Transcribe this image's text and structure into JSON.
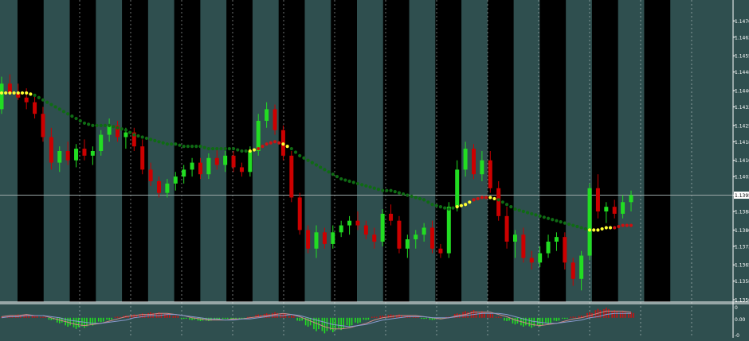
{
  "colors": {
    "background": "#2f4f4f",
    "band_dark": "#000000",
    "band_light": "#2f4f4f",
    "axis": "#ffffff",
    "bull": "#22dd22",
    "bear": "#cc0000",
    "ma_down": "#0f6b14",
    "ma_up": "#cc1111",
    "ma_flat": "#ffff33",
    "current_price_line": "#9aa6a6",
    "osc_pos": "#cc1111",
    "osc_neg": "#22dd22",
    "osc_line1": "#cc8888",
    "osc_line2": "#8899cc"
  },
  "chart_data": [
    {
      "type": "candlestick",
      "title": "",
      "price_axis": {
        "ticks": [
          "1.1470",
          "1.1463",
          "1.1455",
          "1.1448",
          "1.1440",
          "1.1433",
          "1.1425",
          "1.1418",
          "1.1410",
          "1.1403",
          "1.1395",
          "1.1388",
          "1.1380",
          "1.1373",
          "1.1365",
          "1.1358",
          "1.1350"
        ],
        "ylim": [
          1.1349,
          1.1479
        ],
        "current_price": 1.1395,
        "current_price_label": "1.1395"
      },
      "background_bands": 13,
      "candles": [
        [
          1.1432,
          1.1446,
          1.143,
          1.1443
        ],
        [
          1.1443,
          1.1447,
          1.1438,
          1.1439
        ],
        [
          1.1439,
          1.1443,
          1.1436,
          1.1437
        ],
        [
          1.1437,
          1.1441,
          1.1432,
          1.1435
        ],
        [
          1.1435,
          1.1438,
          1.1428,
          1.143
        ],
        [
          1.143,
          1.1433,
          1.1418,
          1.142
        ],
        [
          1.142,
          1.1424,
          1.1406,
          1.1409
        ],
        [
          1.1409,
          1.1416,
          1.1405,
          1.1414
        ],
        [
          1.1414,
          1.1418,
          1.1408,
          1.141
        ],
        [
          1.141,
          1.1417,
          1.1407,
          1.1415
        ],
        [
          1.1415,
          1.1419,
          1.141,
          1.1412
        ],
        [
          1.1412,
          1.1416,
          1.1408,
          1.1414
        ],
        [
          1.1414,
          1.1423,
          1.1412,
          1.1421
        ],
        [
          1.1421,
          1.1428,
          1.1418,
          1.1425
        ],
        [
          1.1425,
          1.1427,
          1.1418,
          1.142
        ],
        [
          1.142,
          1.1424,
          1.1415,
          1.1422
        ],
        [
          1.1422,
          1.1424,
          1.1414,
          1.1416
        ],
        [
          1.1416,
          1.1419,
          1.1404,
          1.1406
        ],
        [
          1.1406,
          1.1409,
          1.1399,
          1.1401
        ],
        [
          1.1401,
          1.1403,
          1.1394,
          1.1396
        ],
        [
          1.1396,
          1.1402,
          1.1394,
          1.14
        ],
        [
          1.14,
          1.1405,
          1.1397,
          1.1403
        ],
        [
          1.1403,
          1.1408,
          1.14,
          1.1406
        ],
        [
          1.1406,
          1.1411,
          1.1403,
          1.1409
        ],
        [
          1.1409,
          1.1411,
          1.1402,
          1.1404
        ],
        [
          1.1404,
          1.1413,
          1.1402,
          1.1411
        ],
        [
          1.1411,
          1.1415,
          1.1406,
          1.1408
        ],
        [
          1.1408,
          1.1414,
          1.1405,
          1.1412
        ],
        [
          1.1412,
          1.1414,
          1.1405,
          1.1407
        ],
        [
          1.1407,
          1.1409,
          1.1403,
          1.1405
        ],
        [
          1.1405,
          1.1416,
          1.1403,
          1.1414
        ],
        [
          1.1414,
          1.143,
          1.1412,
          1.1427
        ],
        [
          1.1427,
          1.1435,
          1.1424,
          1.1432
        ],
        [
          1.1432,
          1.1434,
          1.1421,
          1.1423
        ],
        [
          1.1423,
          1.1425,
          1.141,
          1.1412
        ],
        [
          1.1412,
          1.1414,
          1.1392,
          1.1394
        ],
        [
          1.1394,
          1.1396,
          1.1378,
          1.138
        ],
        [
          1.138,
          1.1382,
          1.137,
          1.1372
        ],
        [
          1.1372,
          1.1382,
          1.1368,
          1.1379
        ],
        [
          1.1379,
          1.1381,
          1.1372,
          1.1374
        ],
        [
          1.1374,
          1.1382,
          1.1372,
          1.1379
        ],
        [
          1.1379,
          1.1384,
          1.1377,
          1.1382
        ],
        [
          1.1382,
          1.1386,
          1.1378,
          1.1384
        ],
        [
          1.1384,
          1.1388,
          1.138,
          1.1382
        ],
        [
          1.1382,
          1.1384,
          1.1376,
          1.1378
        ],
        [
          1.1378,
          1.1381,
          1.1372,
          1.1375
        ],
        [
          1.1375,
          1.1389,
          1.1373,
          1.1387
        ],
        [
          1.1387,
          1.1391,
          1.1382,
          1.1384
        ],
        [
          1.1384,
          1.1386,
          1.137,
          1.1372
        ],
        [
          1.1372,
          1.1378,
          1.1368,
          1.1376
        ],
        [
          1.1376,
          1.138,
          1.1372,
          1.1378
        ],
        [
          1.1378,
          1.1383,
          1.1375,
          1.1381
        ],
        [
          1.1381,
          1.1384,
          1.137,
          1.1372
        ],
        [
          1.1372,
          1.1374,
          1.1368,
          1.137
        ],
        [
          1.137,
          1.1392,
          1.1368,
          1.139
        ],
        [
          1.139,
          1.141,
          1.1388,
          1.1406
        ],
        [
          1.1406,
          1.1418,
          1.1403,
          1.1415
        ],
        [
          1.1415,
          1.1417,
          1.1402,
          1.1404
        ],
        [
          1.1404,
          1.1414,
          1.1401,
          1.141
        ],
        [
          1.141,
          1.1414,
          1.1396,
          1.1398
        ],
        [
          1.1398,
          1.1401,
          1.1384,
          1.1386
        ],
        [
          1.1386,
          1.139,
          1.1372,
          1.1375
        ],
        [
          1.1375,
          1.138,
          1.1368,
          1.1378
        ],
        [
          1.1378,
          1.1381,
          1.1366,
          1.1368
        ],
        [
          1.1368,
          1.1371,
          1.1363,
          1.1366
        ],
        [
          1.1366,
          1.1373,
          1.1364,
          1.137
        ],
        [
          1.137,
          1.1378,
          1.1368,
          1.1375
        ],
        [
          1.1375,
          1.1379,
          1.1371,
          1.1377
        ],
        [
          1.1377,
          1.1379,
          1.1363,
          1.1366
        ],
        [
          1.1366,
          1.1368,
          1.1356,
          1.1359
        ],
        [
          1.1359,
          1.1371,
          1.1354,
          1.1369
        ],
        [
          1.1369,
          1.14,
          1.1367,
          1.1398
        ],
        [
          1.1398,
          1.1404,
          1.1385,
          1.1388
        ],
        [
          1.1388,
          1.1392,
          1.1383,
          1.139
        ],
        [
          1.139,
          1.1393,
          1.1385,
          1.1387
        ],
        [
          1.1387,
          1.1395,
          1.1385,
          1.1392
        ],
        [
          1.1392,
          1.1397,
          1.1388,
          1.1395
        ]
      ],
      "moving_average": [
        1.1439,
        1.1439,
        1.1439,
        1.1439,
        1.1438,
        1.1436,
        1.1434,
        1.1432,
        1.143,
        1.1428,
        1.1426,
        1.1425,
        1.1425,
        1.1425,
        1.1424,
        1.1423,
        1.1421,
        1.142,
        1.1419,
        1.1418,
        1.1417,
        1.1417,
        1.1416,
        1.1416,
        1.1416,
        1.1415,
        1.1415,
        1.1415,
        1.1415,
        1.1414,
        1.1414,
        1.1415,
        1.1417,
        1.1418,
        1.1417,
        1.1415,
        1.1412,
        1.141,
        1.1408,
        1.1406,
        1.1404,
        1.1402,
        1.1401,
        1.14,
        1.1399,
        1.1398,
        1.1397,
        1.1397,
        1.1396,
        1.1395,
        1.1394,
        1.1393,
        1.1391,
        1.139,
        1.1389,
        1.139,
        1.1391,
        1.1393,
        1.1394,
        1.1394,
        1.1393,
        1.1391,
        1.1389,
        1.1388,
        1.1387,
        1.1386,
        1.1385,
        1.1384,
        1.1383,
        1.1382,
        1.1381,
        1.138,
        1.138,
        1.1381,
        1.1381,
        1.1382,
        1.1382
      ],
      "moving_average_slope": [
        "flat",
        "flat",
        "flat",
        "flat",
        "down",
        "down",
        "down",
        "down",
        "down",
        "down",
        "down",
        "down",
        "down",
        "down",
        "down",
        "down",
        "down",
        "down",
        "down",
        "down",
        "down",
        "down",
        "down",
        "down",
        "down",
        "down",
        "down",
        "down",
        "down",
        "down",
        "flat",
        "up",
        "up",
        "up",
        "flat",
        "down",
        "down",
        "down",
        "down",
        "down",
        "down",
        "down",
        "down",
        "down",
        "down",
        "down",
        "down",
        "down",
        "down",
        "down",
        "down",
        "down",
        "down",
        "down",
        "down",
        "flat",
        "flat",
        "up",
        "up",
        "flat",
        "down",
        "down",
        "down",
        "down",
        "down",
        "down",
        "down",
        "down",
        "down",
        "down",
        "down",
        "flat",
        "flat",
        "flat",
        "up",
        "up",
        "up"
      ]
    },
    {
      "type": "histogram",
      "title": "",
      "axis": {
        "ticks": [
          "0",
          "0.00",
          "-0"
        ],
        "ylim": [
          -18,
          12
        ]
      },
      "values": [
        1,
        2,
        3,
        3,
        2,
        1,
        -2,
        -5,
        -8,
        -10,
        -9,
        -7,
        -4,
        -2,
        1,
        2,
        3,
        4,
        5,
        5,
        4,
        2,
        -1,
        -2,
        -3,
        -3,
        -2,
        -1,
        -1,
        -1,
        1,
        3,
        4,
        5,
        4,
        2,
        -3,
        -8,
        -12,
        -14,
        -13,
        -11,
        -8,
        -5,
        -2,
        1,
        2,
        3,
        3,
        2,
        1,
        -1,
        -2,
        -1,
        1,
        4,
        6,
        7,
        6,
        4,
        1,
        -3,
        -6,
        -8,
        -9,
        -8,
        -6,
        -3,
        -1,
        1,
        2,
        5,
        8,
        9,
        7,
        6,
        5
      ],
      "line1": [
        1,
        2,
        2,
        3,
        2,
        2,
        0,
        -2,
        -4,
        -6,
        -7,
        -6,
        -5,
        -3,
        -1,
        1,
        2,
        3,
        3,
        4,
        4,
        3,
        2,
        0,
        -1,
        -2,
        -2,
        -2,
        -1,
        -1,
        0,
        1,
        2,
        3,
        4,
        3,
        1,
        -2,
        -5,
        -8,
        -10,
        -10,
        -9,
        -7,
        -5,
        -2,
        0,
        1,
        2,
        2,
        2,
        1,
        0,
        -1,
        0,
        2,
        3,
        5,
        5,
        5,
        3,
        1,
        -2,
        -4,
        -6,
        -7,
        -6,
        -5,
        -3,
        -1,
        0,
        2,
        4,
        6,
        6,
        6,
        5
      ],
      "line2": [
        0,
        1,
        1,
        2,
        2,
        2,
        1,
        0,
        -2,
        -3,
        -4,
        -5,
        -5,
        -4,
        -3,
        -2,
        0,
        1,
        2,
        2,
        3,
        3,
        2,
        1,
        0,
        -1,
        -1,
        -2,
        -2,
        -1,
        -1,
        0,
        1,
        2,
        2,
        3,
        2,
        0,
        -2,
        -4,
        -6,
        -7,
        -8,
        -7,
        -6,
        -4,
        -2,
        -1,
        0,
        1,
        1,
        1,
        0,
        0,
        0,
        1,
        2,
        3,
        4,
        4,
        4,
        3,
        1,
        -1,
        -3,
        -4,
        -5,
        -5,
        -4,
        -3,
        -2,
        0,
        1,
        3,
        4,
        4,
        4
      ]
    }
  ]
}
